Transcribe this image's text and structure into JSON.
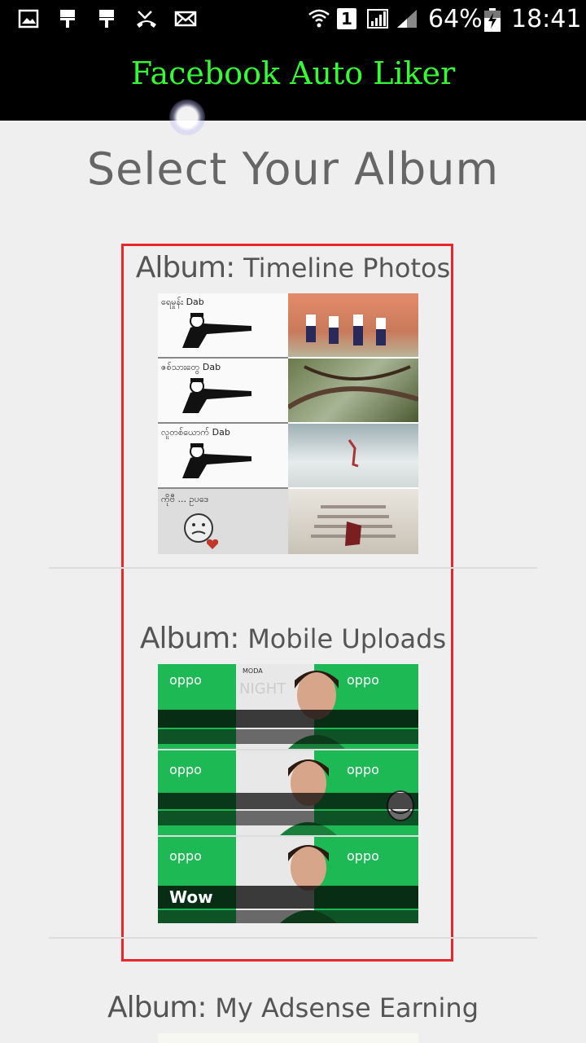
{
  "status_bar": {
    "battery_percent": "64%",
    "time": "18:41",
    "sim_label": "1",
    "icons": [
      "gallery-icon",
      "brush-icon",
      "brush-icon",
      "missed-call-icon",
      "mail-icon",
      "wifi-icon",
      "sim-icon",
      "signal-icon",
      "signal-icon",
      "battery-icon"
    ]
  },
  "app_bar": {
    "title": "Facebook Auto Liker",
    "title_color": "#33ff33"
  },
  "page": {
    "title": "Select Your Album"
  },
  "albums": [
    {
      "prefix": "Album:",
      "name": "Timeline Photos"
    },
    {
      "prefix": "Album:",
      "name": "Mobile Uploads"
    },
    {
      "prefix": "Album:",
      "name": "My Adsense Earning"
    }
  ],
  "thumbnails": {
    "timeline": {
      "caption_tag": "Dab"
    },
    "mobile": {
      "tag_brand": "oppo",
      "tag_event": "MODA",
      "tag_night": "NIGHT",
      "tag_word": "Wow"
    }
  },
  "colors": {
    "background": "#efefef",
    "highlight_border": "#e8262b",
    "text": "#666666"
  }
}
